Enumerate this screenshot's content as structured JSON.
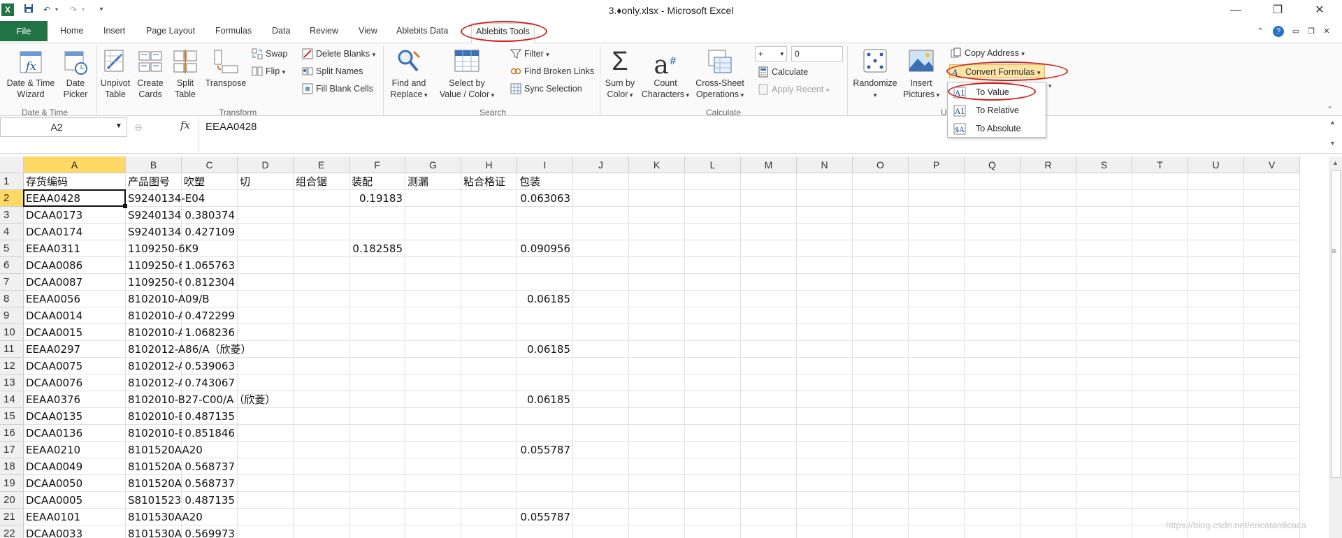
{
  "window": {
    "title": "3.♦only.xlsx - Microsoft Excel"
  },
  "qat": {
    "save": "save-icon",
    "undo": "undo-icon",
    "redo": "redo-icon"
  },
  "tabs": [
    "Home",
    "Insert",
    "Page Layout",
    "Formulas",
    "Data",
    "Review",
    "View",
    "Ablebits Data",
    "Ablebits Tools"
  ],
  "file_tab": "File",
  "ribbon": {
    "date_time_wizard": "Date & Time\nWizard",
    "date_picker": "Date\nPicker",
    "grp_datetime": "Date & Time",
    "unpivot": "Unpivot\nTable",
    "create_cards": "Create\nCards",
    "split_table": "Split\nTable",
    "transpose": "Transpose",
    "swap": "Swap",
    "flip": "Flip",
    "delete_blanks": "Delete Blanks",
    "split_names": "Split Names",
    "fill_blank_cells": "Fill Blank Cells",
    "grp_transform": "Transform",
    "find_replace": "Find and\nReplace",
    "select_by_value": "Select by\nValue / Color",
    "filter": "Filter",
    "find_broken_links": "Find Broken Links",
    "sync_selection": "Sync Selection",
    "grp_search": "Search",
    "sum_by_color": "Sum by\nColor",
    "count_characters": "Count\nCharacters",
    "cross_sheet": "Cross-Sheet\nOperations",
    "calc_operator": "+",
    "calc_value": "0",
    "calculate": "Calculate",
    "apply_recent": "Apply Recent",
    "grp_calculate": "Calculate",
    "randomize": "Randomize",
    "insert_pictures": "Insert\nPictures",
    "copy_address": "Copy Address",
    "convert_formulas": "Convert Formulas",
    "grp_utilities": "U"
  },
  "convert_menu": [
    "To Value",
    "To Relative",
    "To Absolute"
  ],
  "formula_bar": {
    "name_box": "A2",
    "fx": "fx",
    "value": "EEAA0428"
  },
  "columns": [
    {
      "id": "A"
    },
    {
      "id": "B"
    },
    {
      "id": "C"
    },
    {
      "id": "D"
    },
    {
      "id": "E"
    },
    {
      "id": "F"
    },
    {
      "id": "G"
    },
    {
      "id": "H"
    },
    {
      "id": "I"
    },
    {
      "id": "J"
    },
    {
      "id": "K"
    },
    {
      "id": "L"
    },
    {
      "id": "M"
    },
    {
      "id": "N"
    },
    {
      "id": "O"
    },
    {
      "id": "P"
    },
    {
      "id": "Q"
    },
    {
      "id": "R"
    },
    {
      "id": "S"
    },
    {
      "id": "T"
    },
    {
      "id": "U"
    },
    {
      "id": "V"
    }
  ],
  "rows": [
    {
      "n": "1",
      "A": "存货编码",
      "B": "产品图号",
      "C": "吹塑",
      "D": "切",
      "E": "组合锯",
      "F": "装配",
      "G": "测漏",
      "H": "粘合格证",
      "I": "包装"
    },
    {
      "n": "2",
      "A": "EEAA0428",
      "B": "S9240134-E04",
      "F": "0.19183",
      "I": "0.063063"
    },
    {
      "n": "3",
      "A": "DCAA0173",
      "B": "S9240134-",
      "C": "0.380374"
    },
    {
      "n": "4",
      "A": "DCAA0174",
      "B": "S9240134-",
      "C": "0.427109"
    },
    {
      "n": "5",
      "A": "EEAA0311",
      "B": "1109250-6K9",
      "F": "0.182585",
      "I": "0.090956"
    },
    {
      "n": "6",
      "A": "DCAA0086",
      "B": "1109250-6",
      "C": "1.065763"
    },
    {
      "n": "7",
      "A": "DCAA0087",
      "B": "1109250-6",
      "C": "0.812304"
    },
    {
      "n": "8",
      "A": "EEAA0056",
      "B": "8102010-A09/B",
      "I": "0.06185"
    },
    {
      "n": "9",
      "A": "DCAA0014",
      "B": "8102010-A",
      "C": "0.472299"
    },
    {
      "n": "10",
      "A": "DCAA0015",
      "B": "8102010-A",
      "C": "1.068236"
    },
    {
      "n": "11",
      "A": "EEAA0297",
      "B": "8102012-A86/A（欣菱）",
      "I": "0.06185"
    },
    {
      "n": "12",
      "A": "DCAA0075",
      "B": "8102012-A",
      "C": "0.539063"
    },
    {
      "n": "13",
      "A": "DCAA0076",
      "B": "8102012-A",
      "C": "0.743067"
    },
    {
      "n": "14",
      "A": "EEAA0376",
      "B": "8102010-B27-C00/A（欣菱）",
      "I": "0.06185"
    },
    {
      "n": "15",
      "A": "DCAA0135",
      "B": "8102010-E",
      "C": "0.487135"
    },
    {
      "n": "16",
      "A": "DCAA0136",
      "B": "8102010-E",
      "C": "0.851846"
    },
    {
      "n": "17",
      "A": "EEAA0210",
      "B": "8101520AA20",
      "I": "0.055787"
    },
    {
      "n": "18",
      "A": "DCAA0049",
      "B": "8101520A/",
      "C": "0.568737"
    },
    {
      "n": "19",
      "A": "DCAA0050",
      "B": "8101520A/",
      "C": "0.568737"
    },
    {
      "n": "20",
      "A": "DCAA0005",
      "B": "S8101523-",
      "C": "0.487135"
    },
    {
      "n": "21",
      "A": "EEAA0101",
      "B": "8101530AA20",
      "I": "0.055787"
    },
    {
      "n": "22",
      "A": "DCAA0033",
      "B": "8101530A/",
      "C": "0.569973"
    }
  ],
  "watermark": "https://blog.csdn.net/ericatardicaca"
}
